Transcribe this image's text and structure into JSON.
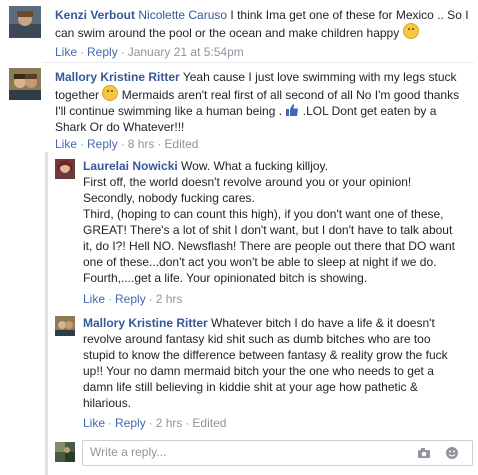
{
  "comments": [
    {
      "author": "Kenzi Verbout",
      "mention": "Nicolette Caruso",
      "text_line1": " I think Ima get one of these for Mexico .. So I",
      "text_line2": "can swim around the pool or the ocean and make children happy",
      "actions": {
        "like": "Like",
        "reply": "Reply",
        "time": "January 21 at 5:54pm"
      }
    },
    {
      "author": "Mallory Kristine Ritter",
      "text_line1": " Yeah cause I just love swimming with my legs stuck",
      "text_line2a": "together ",
      "text_line2b": " Mermaids aren't real first of all second of all No I'm good thanks",
      "text_line3a": "I'll continue swimming like a human being . ",
      "text_line3b": " .LOL Dont get eaten by a",
      "text_line4": "Shark Or do Whatever!!!",
      "actions": {
        "like": "Like",
        "reply": "Reply",
        "time": "8 hrs",
        "edited": "Edited"
      }
    }
  ],
  "replies": [
    {
      "author": "Laurelai Nowicki",
      "lines": [
        " Wow. What a fucking killjoy.",
        "First off, the world doesn't revolve around you or your opinion!",
        "Secondly, nobody fucking cares.",
        "Third, (hoping to can count this high), if you don't want one of these,",
        "GREAT! There's a lot of shit I don't want, but I don't have to talk about",
        "it, do I?! Hell NO. Newsflash! There are people out there that DO want",
        "one of these...don't act you won't be able to sleep at night if we do.",
        "Fourth,....get a life. Your opinionated bitch is showing."
      ],
      "actions": {
        "like": "Like",
        "reply": "Reply",
        "time": "2 hrs"
      }
    },
    {
      "author": "Mallory Kristine Ritter",
      "lines": [
        " Whatever bitch I do have a life & it doesn't",
        "revolve around fantasy kid shit such as dumb bitches who are too",
        "stupid to know the difference between fantasy & reality grow the fuck",
        "up!! Your no damn mermaid bitch your the one who needs to get a",
        "damn life still believing in kiddie shit at your age how pathetic &",
        "hilarious."
      ],
      "actions": {
        "like": "Like",
        "reply": "Reply",
        "time": "2 hrs",
        "edited": "Edited"
      }
    }
  ],
  "reply_box": {
    "placeholder": "Write a reply..."
  },
  "icons": {
    "emoji": "smiley-emoji-icon",
    "thumb": "thumbs-up-icon",
    "camera": "camera-icon",
    "sticker": "sticker-icon"
  },
  "colors": {
    "link": "#365899",
    "action": "#4267b2",
    "muted": "#90949c"
  }
}
